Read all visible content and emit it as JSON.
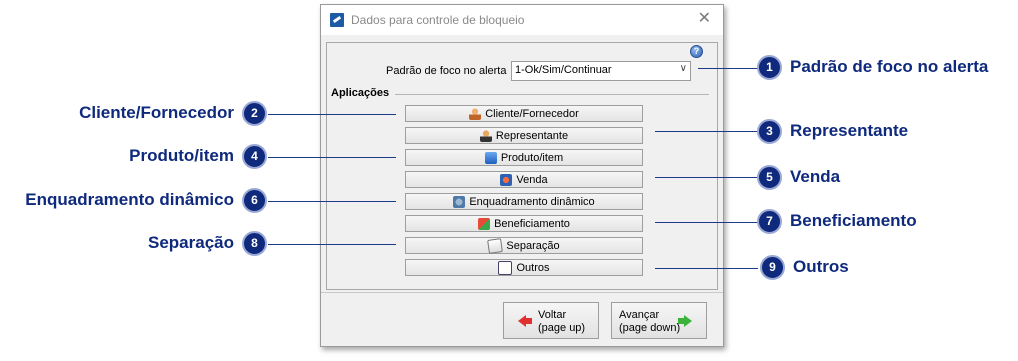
{
  "dialog": {
    "title": "Dados para controle de bloqueio",
    "help_icon": "?",
    "focus_label": "Padrão de foco no alerta",
    "focus_value": "1-Ok/Sim/Continuar",
    "section_title": "Aplicações",
    "buttons": [
      {
        "label": "Cliente/Fornecedor",
        "icon": "client-icon"
      },
      {
        "label": "Representante",
        "icon": "representative-icon"
      },
      {
        "label": "Produto/item",
        "icon": "product-icon"
      },
      {
        "label": "Venda",
        "icon": "sale-icon"
      },
      {
        "label": "Enquadramento dinâmico",
        "icon": "gear-icon"
      },
      {
        "label": "Beneficiamento",
        "icon": "processing-icon"
      },
      {
        "label": "Separação",
        "icon": "separation-icon"
      },
      {
        "label": "Outros",
        "icon": "checklist-icon"
      }
    ],
    "back_line1": "Voltar",
    "back_line2": "(page up)",
    "next_line1": "Avançar",
    "next_line2": "(page down)"
  },
  "callouts": [
    {
      "num": "1",
      "text": "Padrão de foco no alerta"
    },
    {
      "num": "2",
      "text": "Cliente/Fornecedor"
    },
    {
      "num": "3",
      "text": "Representante"
    },
    {
      "num": "4",
      "text": "Produto/item"
    },
    {
      "num": "5",
      "text": "Venda"
    },
    {
      "num": "6",
      "text": "Enquadramento dinâmico"
    },
    {
      "num": "7",
      "text": "Beneficiamento"
    },
    {
      "num": "8",
      "text": "Separação"
    },
    {
      "num": "9",
      "text": "Outros"
    }
  ],
  "colors": {
    "callout": "#0f2a7c",
    "back_arrow": "#e23030",
    "next_arrow": "#3bb33b"
  }
}
